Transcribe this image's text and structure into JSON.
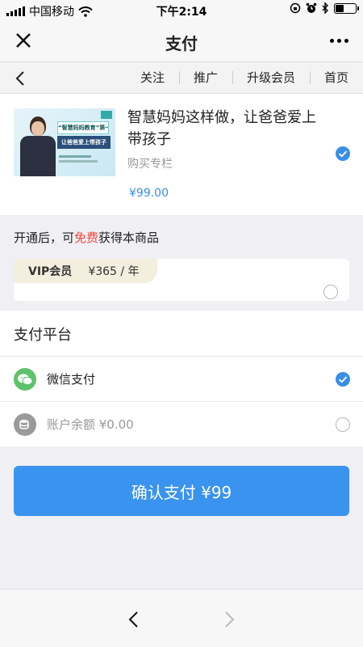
{
  "status_bar": {
    "carrier": "中国移动",
    "time": "下午2:14"
  },
  "title_bar": {
    "title": "支付"
  },
  "nav": {
    "links": [
      "关注",
      "推广",
      "升级会员",
      "首页"
    ]
  },
  "product": {
    "thumb_line1": "“智慧妈妈教育”第一课",
    "thumb_line2": "让爸爸爱上带孩子",
    "title": "智慧妈妈这样做，让爸爸爱上带孩子",
    "subtitle": "购买专栏",
    "price": "¥99.00",
    "selected": true
  },
  "membership": {
    "notice_prefix": "开通后，可",
    "notice_free": "免费",
    "notice_suffix": "获得本商品",
    "vip_name": "VIP会员",
    "vip_price": "¥365 / 年",
    "selected": false
  },
  "platform": {
    "title": "支付平台",
    "options": [
      {
        "label": "微信支付",
        "selected": true,
        "icon": "wechat-pay-icon",
        "color": "#5ec26a"
      },
      {
        "label": "账户余额 ¥0.00",
        "selected": false,
        "icon": "balance-icon",
        "color": "#9a9a9a"
      }
    ]
  },
  "confirm": {
    "label": "确认支付 ¥99"
  },
  "colors": {
    "accent": "#3a93ee",
    "free_red": "#f24b3e"
  }
}
